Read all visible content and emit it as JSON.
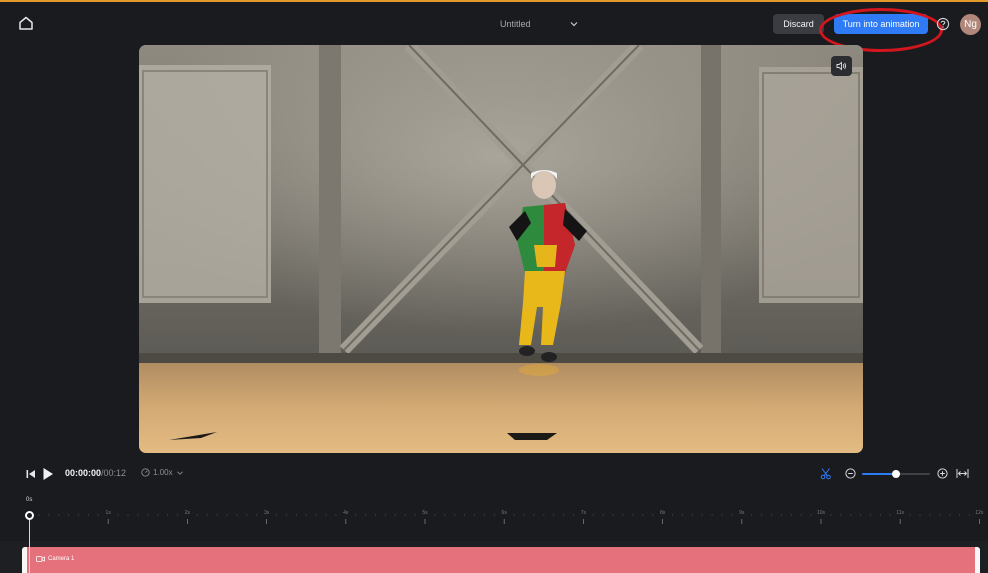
{
  "header": {
    "title": "Untitled",
    "discard_label": "Discard",
    "primary_action_label": "Turn into animation",
    "avatar_initials": "Ng",
    "icons": {
      "home": "home-icon",
      "title_menu": "chevron-down-icon",
      "help": "help-circle-icon"
    }
  },
  "video": {
    "volume_icon": "speaker-icon"
  },
  "playback": {
    "current_time": "00:00:00",
    "total_time": "/00:12",
    "speed": "1.00x",
    "zoom_level": 0.5,
    "icons": {
      "skip_start": "skip-to-start-icon",
      "play": "play-icon",
      "speed": "speedometer-icon",
      "cut": "scissors-icon",
      "zoom_out": "zoom-out-icon",
      "zoom_in": "zoom-in-icon",
      "fit": "fit-timeline-icon"
    }
  },
  "timeline": {
    "start_label": "0s",
    "second_labels": [
      "1s",
      "2s",
      "3s",
      "4s",
      "5s",
      "6s",
      "7s",
      "8s",
      "9s",
      "10s",
      "11s",
      "12s"
    ],
    "clips": [
      {
        "label": "Camera 1",
        "icon": "camera-icon"
      }
    ]
  },
  "colors": {
    "accent": "#2f7bf5",
    "highlight_ring": "#d3161d",
    "clip": "#e4717b",
    "background": "#1a1b1e",
    "top_border": "#e39a2d"
  }
}
